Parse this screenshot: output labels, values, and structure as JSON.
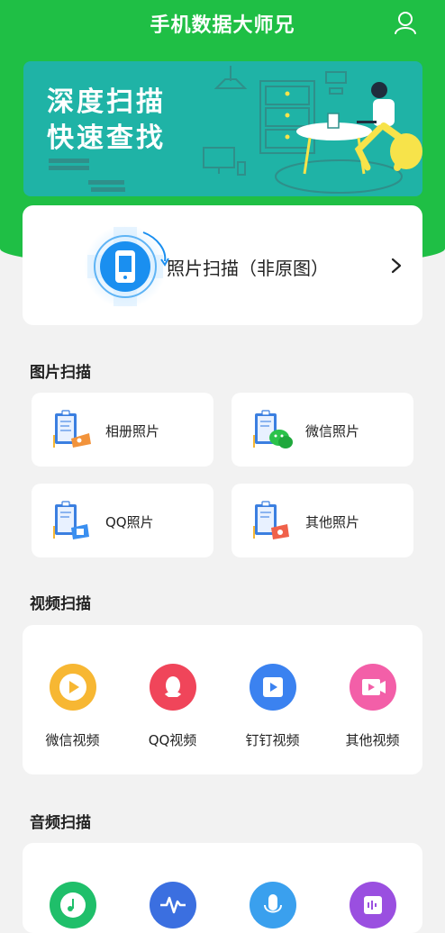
{
  "app": {
    "title": "手机数据大师兄"
  },
  "header": {
    "user_icon": "user-icon"
  },
  "banner": {
    "line1": "深度扫描",
    "line2": "快速查找"
  },
  "photo_scan_card": {
    "label": "照片扫描（非原图）",
    "icon": "phone-scan-icon"
  },
  "sections": {
    "image": {
      "title": "图片扫描",
      "items": [
        {
          "label": "相册照片",
          "icon": "album-photo-icon"
        },
        {
          "label": "微信照片",
          "icon": "wechat-photo-icon"
        },
        {
          "label": "QQ照片",
          "icon": "qq-photo-icon"
        },
        {
          "label": "其他照片",
          "icon": "other-photo-icon"
        }
      ]
    },
    "video": {
      "title": "视频扫描",
      "items": [
        {
          "label": "微信视频",
          "icon": "wechat-video-icon",
          "color": "#f7b733"
        },
        {
          "label": "QQ视频",
          "icon": "qq-video-icon",
          "color": "#f0455a"
        },
        {
          "label": "钉钉视频",
          "icon": "dingtalk-video-icon",
          "color": "#3b82f0"
        },
        {
          "label": "其他视频",
          "icon": "other-video-icon",
          "color": "#f35fa8"
        }
      ]
    },
    "audio": {
      "title": "音频扫描",
      "items": [
        {
          "icon": "music-icon",
          "color": "#1fbf6a"
        },
        {
          "icon": "waveform-icon",
          "color": "#3b6fe0"
        },
        {
          "icon": "microphone-icon",
          "color": "#3aa0ee"
        },
        {
          "icon": "voice-file-icon",
          "color": "#9a4fe0"
        }
      ]
    }
  },
  "colors": {
    "brand": "#1fbf45",
    "banner": "#1fb3a6",
    "background": "#f2f2f2"
  }
}
